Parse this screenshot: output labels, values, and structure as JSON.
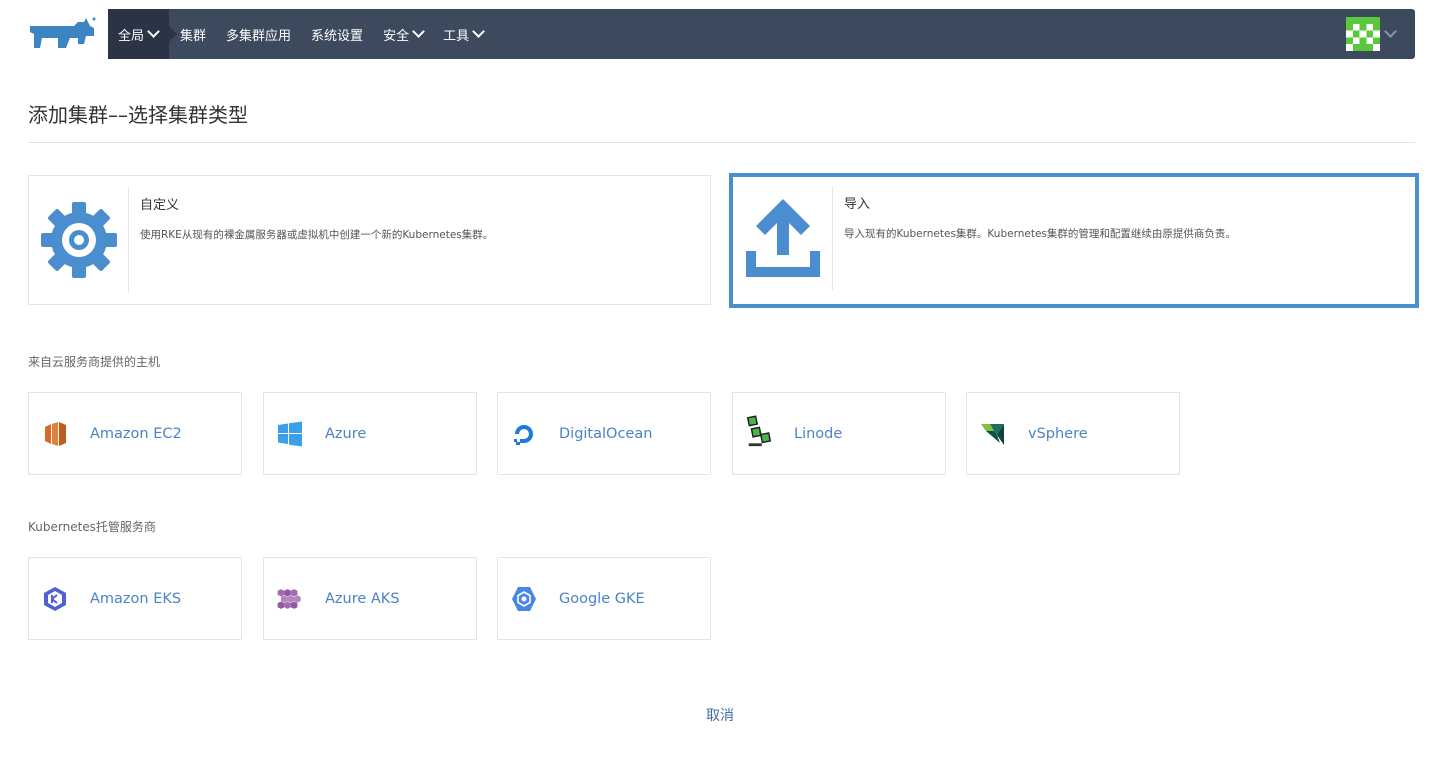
{
  "nav": {
    "items": [
      {
        "label": "全局",
        "dropdown": true,
        "active": true
      },
      {
        "label": "集群",
        "dropdown": false
      },
      {
        "label": "多集群应用",
        "dropdown": false
      },
      {
        "label": "系统设置",
        "dropdown": false
      },
      {
        "label": "安全",
        "dropdown": true
      },
      {
        "label": "工具",
        "dropdown": true
      }
    ]
  },
  "page": {
    "title": "添加集群––选择集群类型"
  },
  "cluster_types": [
    {
      "title": "自定义",
      "description": "使用RKE从现有的裸金属服务器或虚拟机中创建一个新的Kubernetes集群。",
      "icon": "gear-icon",
      "selected": false
    },
    {
      "title": "导入",
      "description": "导入现有的Kubernetes集群。Kubernetes集群的管理和配置继续由原提供商负责。",
      "icon": "upload-icon",
      "selected": true
    }
  ],
  "cloud_section": {
    "label": "来自云服务商提供的主机",
    "providers": [
      {
        "label": "Amazon EC2",
        "icon": "amazon-ec2-icon"
      },
      {
        "label": "Azure",
        "icon": "azure-icon"
      },
      {
        "label": "DigitalOcean",
        "icon": "digitalocean-icon"
      },
      {
        "label": "Linode",
        "icon": "linode-icon"
      },
      {
        "label": "vSphere",
        "icon": "vsphere-icon"
      }
    ]
  },
  "hosted_section": {
    "label": "Kubernetes托管服务商",
    "providers": [
      {
        "label": "Amazon EKS",
        "icon": "amazon-eks-icon"
      },
      {
        "label": "Azure AKS",
        "icon": "azure-aks-icon"
      },
      {
        "label": "Google GKE",
        "icon": "google-gke-icon"
      }
    ]
  },
  "footer": {
    "cancel_label": "取消"
  },
  "colors": {
    "nav_bg": "#3d4a5e",
    "nav_active": "#2b3445",
    "accent": "#4a90d0",
    "link": "#4a84c4"
  }
}
